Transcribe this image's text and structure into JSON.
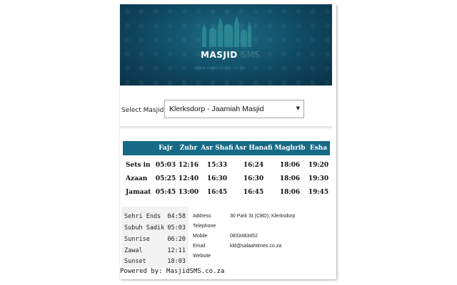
{
  "brand": {
    "logo": "MASJID",
    "logo_suffix": "SMS",
    "tagline": "www.masjidsms.co.za"
  },
  "select": {
    "label": "Select Masjid",
    "value": "Klerksdorp - Jaamiah Masjid"
  },
  "times": {
    "headers": [
      "",
      "Fajr",
      "Zuhr",
      "Asr Shafi",
      "Asr Hanafi",
      "Maghrib",
      "Esha"
    ],
    "rows": [
      {
        "label": "Sets in",
        "values": [
          "05:03",
          "12:16",
          "15:33",
          "16:24",
          "18:06",
          "19:20"
        ]
      },
      {
        "label": "Azaan",
        "values": [
          "05:25",
          "12:40",
          "16:30",
          "16:30",
          "18:06",
          "19:30"
        ]
      },
      {
        "label": "Jamaat",
        "values": [
          "05:45",
          "13:00",
          "16:45",
          "16:45",
          "18:06",
          "19:45"
        ]
      }
    ]
  },
  "sun": [
    {
      "label": "Sehri Ends",
      "time": "04:58"
    },
    {
      "label": "Subuh Sadik",
      "time": "05:03"
    },
    {
      "label": "Sunrise",
      "time": "06:20"
    },
    {
      "label": "Zawal",
      "time": "12:11"
    },
    {
      "label": "Sunset",
      "time": "18:03"
    }
  ],
  "contact": [
    {
      "label": "Address",
      "value": "30 Park St (CBD), Klerksdorp"
    },
    {
      "label": "Telephone",
      "value": ""
    },
    {
      "label": "Mobile",
      "value": "0833483452"
    },
    {
      "label": "Email",
      "value": "kld@salaahtimes.co.za"
    },
    {
      "label": "Website",
      "value": ""
    }
  ],
  "footer": {
    "powered_by": "Powered by: MasjidSMS.co.za"
  },
  "colors": {
    "banner": "#0f4861",
    "header_row": "#176a86",
    "sun_panel": "#f2f2f2"
  }
}
